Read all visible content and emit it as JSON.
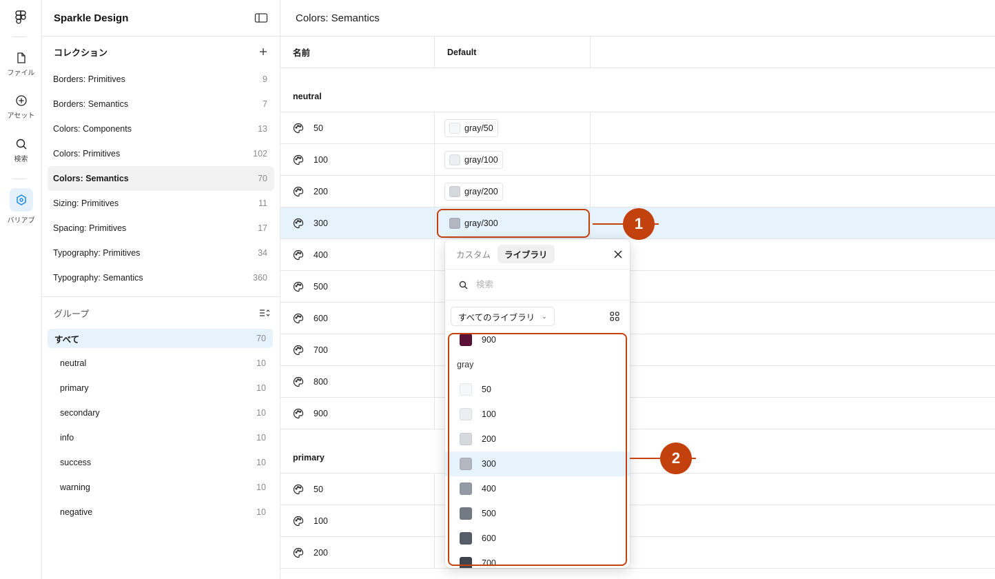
{
  "rail": {
    "items": [
      {
        "label": "ファイル",
        "icon": "file-icon"
      },
      {
        "label": "アセット",
        "icon": "add-circle-icon"
      },
      {
        "label": "検索",
        "icon": "search-icon"
      },
      {
        "label": "バリアブ",
        "icon": "variables-icon"
      }
    ]
  },
  "sidebar": {
    "title": "Sparkle Design",
    "collections_title": "コレクション",
    "collections": [
      {
        "name": "Borders: Primitives",
        "count": "9"
      },
      {
        "name": "Borders: Semantics",
        "count": "7"
      },
      {
        "name": "Colors: Components",
        "count": "13"
      },
      {
        "name": "Colors: Primitives",
        "count": "102"
      },
      {
        "name": "Colors: Semantics",
        "count": "70"
      },
      {
        "name": "Sizing: Primitives",
        "count": "11"
      },
      {
        "name": "Spacing: Primitives",
        "count": "17"
      },
      {
        "name": "Typography: Primitives",
        "count": "34"
      },
      {
        "name": "Typography: Semantics",
        "count": "360"
      }
    ],
    "groups_title": "グループ",
    "groups": [
      {
        "name": "すべて",
        "count": "70"
      },
      {
        "name": "neutral",
        "count": "10"
      },
      {
        "name": "primary",
        "count": "10"
      },
      {
        "name": "secondary",
        "count": "10"
      },
      {
        "name": "info",
        "count": "10"
      },
      {
        "name": "success",
        "count": "10"
      },
      {
        "name": "warning",
        "count": "10"
      },
      {
        "name": "negative",
        "count": "10"
      }
    ]
  },
  "main": {
    "title": "Colors: Semantics",
    "col_name": "名前",
    "col_default": "Default",
    "group_neutral": "neutral",
    "group_primary": "primary",
    "neutral_rows": [
      {
        "name": "50",
        "value": "gray/50",
        "color": "#f6f7f8"
      },
      {
        "name": "100",
        "value": "gray/100",
        "color": "#eceef1"
      },
      {
        "name": "200",
        "value": "gray/200",
        "color": "#d5d8dd"
      },
      {
        "name": "300",
        "value": "gray/300",
        "color": "#b3b8c0"
      },
      {
        "name": "400"
      },
      {
        "name": "500"
      },
      {
        "name": "600"
      },
      {
        "name": "700"
      },
      {
        "name": "800"
      },
      {
        "name": "900"
      }
    ],
    "primary_rows": [
      {
        "name": "50"
      },
      {
        "name": "100"
      },
      {
        "name": "200"
      }
    ]
  },
  "popover": {
    "tab_custom": "カスタム",
    "tab_library": "ライブラリ",
    "search_placeholder": "検索",
    "library_filter": "すべてのライブラリ",
    "prev_item": {
      "name": "900",
      "color": "#5b1136"
    },
    "group_label": "gray",
    "items": [
      {
        "name": "50",
        "color": "#f6f7f8"
      },
      {
        "name": "100",
        "color": "#eceef1"
      },
      {
        "name": "200",
        "color": "#d5d8dd"
      },
      {
        "name": "300",
        "color": "#b3b8c0"
      },
      {
        "name": "400",
        "color": "#959ba4"
      },
      {
        "name": "500",
        "color": "#747a84"
      },
      {
        "name": "600",
        "color": "#585e68"
      },
      {
        "name": "700",
        "color": "#3f444d"
      }
    ]
  },
  "callouts": [
    "1",
    "2"
  ],
  "colors": {
    "accent": "#c2410c",
    "selection": "#e6f2fc"
  }
}
